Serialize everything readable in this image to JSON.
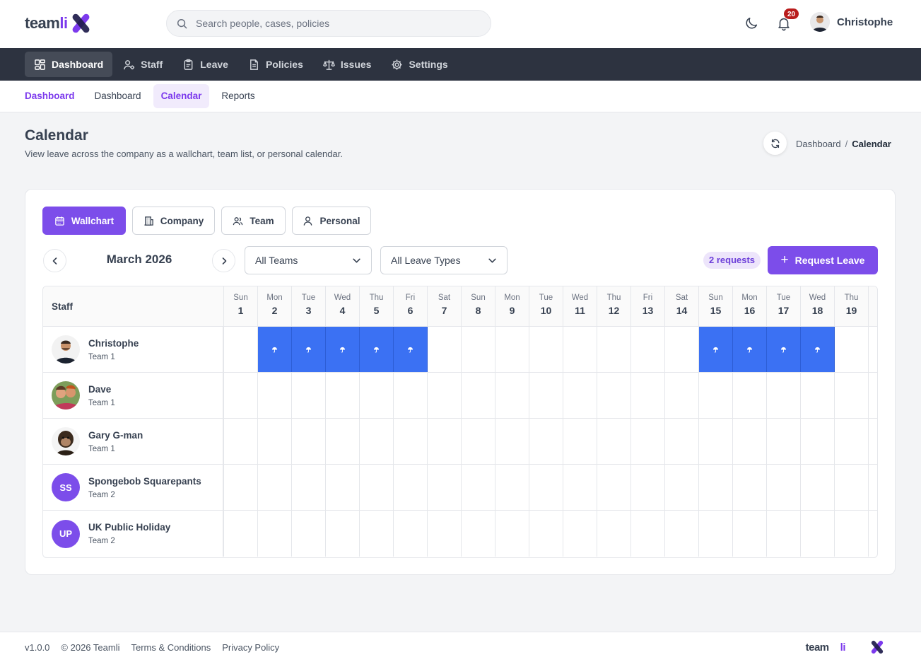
{
  "brand": {
    "name_part1": "team",
    "name_part2": "li",
    "accent": "#7c3aed"
  },
  "search": {
    "placeholder": "Search people, cases, policies"
  },
  "header": {
    "notification_count": "20",
    "user_name": "Christophe",
    "icons": [
      "moon-icon",
      "bell-icon"
    ]
  },
  "main_nav": [
    {
      "label": "Dashboard",
      "icon": "dashboard-icon",
      "active": true
    },
    {
      "label": "Staff",
      "icon": "staff-icon"
    },
    {
      "label": "Leave",
      "icon": "clipboard-icon"
    },
    {
      "label": "Policies",
      "icon": "document-icon"
    },
    {
      "label": "Issues",
      "icon": "scales-icon"
    },
    {
      "label": "Settings",
      "icon": "gear-icon"
    }
  ],
  "sub_nav": {
    "section": "Dashboard",
    "items": [
      "Dashboard",
      "Calendar",
      "Reports"
    ],
    "active": "Calendar"
  },
  "page": {
    "title": "Calendar",
    "description": "View leave across the company as a wallchart, team list, or personal calendar.",
    "breadcrumb": [
      "Dashboard",
      "Calendar"
    ]
  },
  "views": [
    {
      "label": "Wallchart",
      "icon": "calendar-icon",
      "active": true
    },
    {
      "label": "Company",
      "icon": "building-icon"
    },
    {
      "label": "Team",
      "icon": "team-icon"
    },
    {
      "label": "Personal",
      "icon": "person-icon"
    }
  ],
  "calendar": {
    "month_label": "March 2026",
    "team_filter": "All Teams",
    "leave_type_filter": "All Leave Types",
    "requests_badge": "2 requests",
    "request_button": "Request Leave",
    "staff_header": "Staff",
    "leave_color": "#3b71f3",
    "days": [
      {
        "name": "Sun",
        "num": "1"
      },
      {
        "name": "Mon",
        "num": "2"
      },
      {
        "name": "Tue",
        "num": "3"
      },
      {
        "name": "Wed",
        "num": "4"
      },
      {
        "name": "Thu",
        "num": "5"
      },
      {
        "name": "Fri",
        "num": "6"
      },
      {
        "name": "Sat",
        "num": "7"
      },
      {
        "name": "Sun",
        "num": "8"
      },
      {
        "name": "Mon",
        "num": "9"
      },
      {
        "name": "Tue",
        "num": "10"
      },
      {
        "name": "Wed",
        "num": "11"
      },
      {
        "name": "Thu",
        "num": "12"
      },
      {
        "name": "Fri",
        "num": "13"
      },
      {
        "name": "Sat",
        "num": "14"
      },
      {
        "name": "Sun",
        "num": "15"
      },
      {
        "name": "Mon",
        "num": "16"
      },
      {
        "name": "Tue",
        "num": "17"
      },
      {
        "name": "Wed",
        "num": "18"
      },
      {
        "name": "Thu",
        "num": "19"
      }
    ],
    "staff": [
      {
        "name": "Christophe",
        "team": "Team 1",
        "avatar": "photo",
        "leave_days": [
          "2",
          "3",
          "4",
          "5",
          "6",
          "15",
          "16",
          "17",
          "18"
        ]
      },
      {
        "name": "Dave",
        "team": "Team 1",
        "avatar": "photo",
        "leave_days": []
      },
      {
        "name": "Gary G-man",
        "team": "Team 1",
        "avatar": "photo",
        "leave_days": []
      },
      {
        "name": "Spongebob Squarepants",
        "team": "Team 2",
        "initials": "SS",
        "leave_days": []
      },
      {
        "name": "UK Public Holiday",
        "team": "Team 2",
        "initials": "UP",
        "leave_days": []
      }
    ]
  },
  "footer": {
    "version": "v1.0.0",
    "copyright": "© 2026 Teamli",
    "links": [
      "Terms & Conditions",
      "Privacy Policy"
    ]
  }
}
